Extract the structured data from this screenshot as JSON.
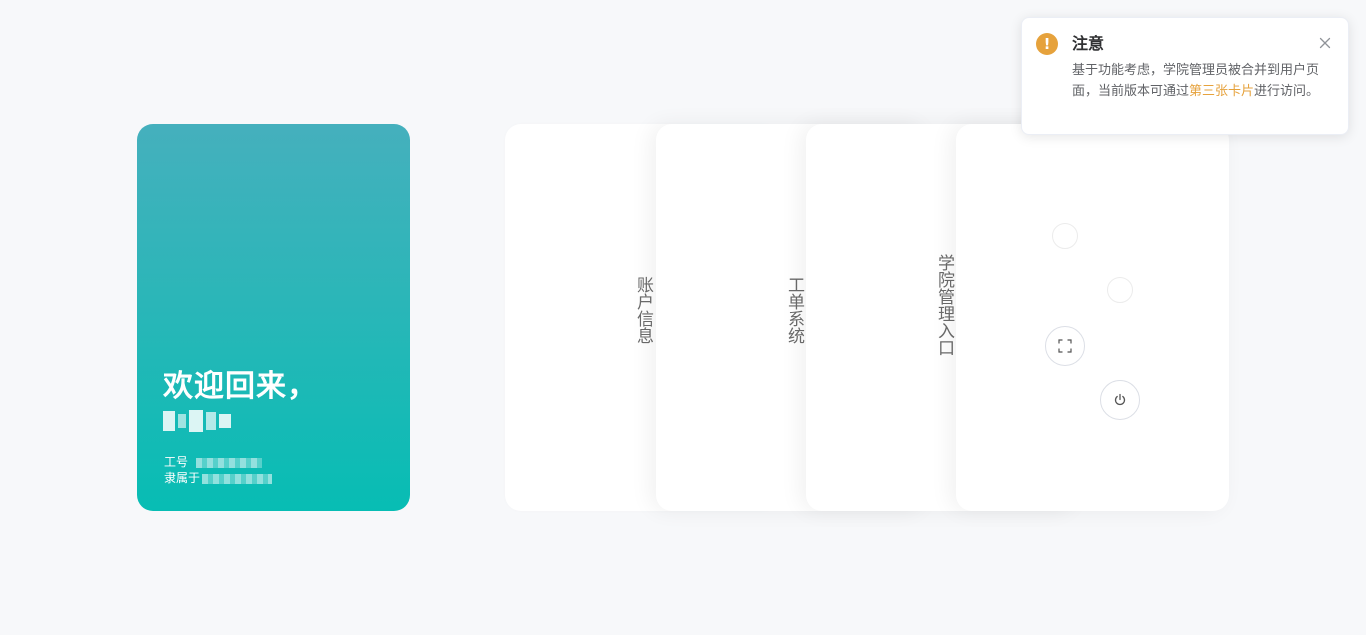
{
  "welcome": {
    "greeting": "欢迎回来，",
    "employee_id_label": "工号",
    "belongs_to_label": "隶属于"
  },
  "cards": [
    {
      "label": "账户信息"
    },
    {
      "label": "工单系统"
    },
    {
      "label": "学院管理入口"
    },
    {
      "label": ""
    }
  ],
  "icons": {
    "fullscreen": "fullscreen-icon",
    "power": "power-icon",
    "warning": "warning-icon",
    "close": "close-icon"
  },
  "notification": {
    "icon_glyph": "!",
    "title": "注意",
    "body_before": "基于功能考虑，学院管理员被合并到用户页面，当前版本可通过",
    "body_link": "第三张卡片",
    "body_after": "进行访问。"
  },
  "colors": {
    "accent_teal": "#07bdb4",
    "warning": "#e6a23c"
  }
}
